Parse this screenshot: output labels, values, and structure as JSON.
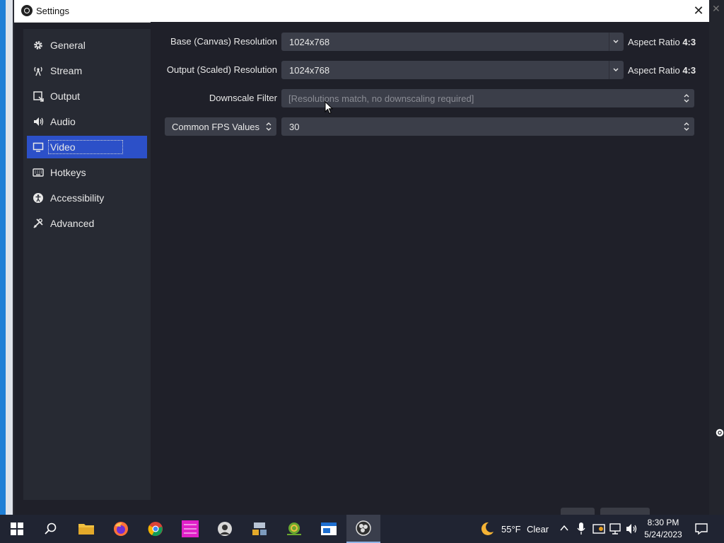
{
  "window": {
    "title": "Settings"
  },
  "sidebar": {
    "items": [
      {
        "label": "General"
      },
      {
        "label": "Stream"
      },
      {
        "label": "Output"
      },
      {
        "label": "Audio"
      },
      {
        "label": "Video"
      },
      {
        "label": "Hotkeys"
      },
      {
        "label": "Accessibility"
      },
      {
        "label": "Advanced"
      }
    ],
    "selected": "Video"
  },
  "video": {
    "base_label": "Base (Canvas) Resolution",
    "base_value": "1024x768",
    "base_aspect_prefix": "Aspect Ratio",
    "base_aspect_value": "4:3",
    "output_label": "Output (Scaled) Resolution",
    "output_value": "1024x768",
    "output_aspect_prefix": "Aspect Ratio",
    "output_aspect_value": "4:3",
    "downscale_label": "Downscale Filter",
    "downscale_value": "[Resolutions match, no downscaling required]",
    "fps_type": "Common FPS Values",
    "fps_value": "30"
  },
  "taskbar": {
    "weather_temp": "55°F",
    "weather_condition": "Clear",
    "time": "8:30 PM",
    "date": "5/24/2023",
    "apps": [
      "start",
      "search",
      "file-explorer",
      "firefox",
      "chrome",
      "pink-app",
      "person-app",
      "network-app",
      "snail-app",
      "blue-app",
      "obs"
    ]
  },
  "colors": {
    "accent": "#2c50c8",
    "window_bg": "#1f2029",
    "field_bg": "#3b3e49"
  }
}
